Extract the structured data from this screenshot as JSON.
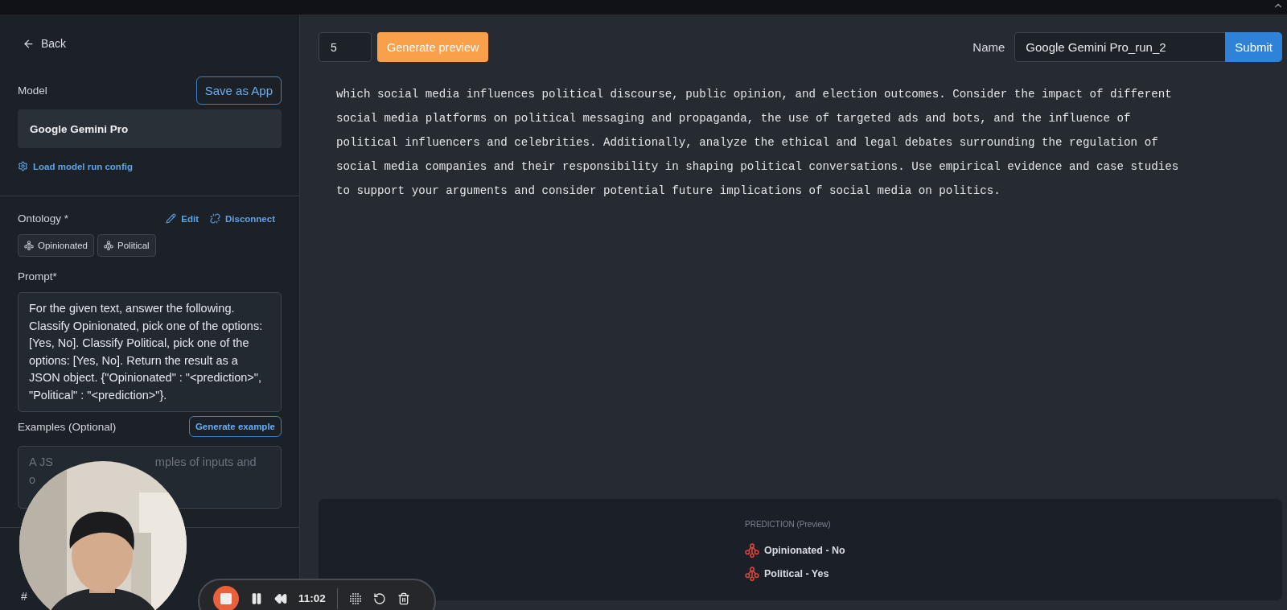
{
  "back": {
    "label": "Back"
  },
  "model": {
    "label": "Model",
    "save_button": "Save as App",
    "value": "Google Gemini Pro",
    "config_link": "Load model run config"
  },
  "ontology": {
    "label": "Ontology *",
    "edit": "Edit",
    "disconnect": "Disconnect",
    "chips": [
      "Opinionated",
      "Political"
    ]
  },
  "prompt": {
    "label": "Prompt*",
    "value": "For the given text, answer the following. Classify Opinionated, pick one of the options: [Yes, No]. Classify Political, pick one of the options: [Yes, No]. Return the result as a JSON object. {\"Opinionated\" : \"<prediction>\", \"Political\" : \"<prediction>\"}."
  },
  "examples": {
    "label": "Examples (Optional)",
    "button": "Generate example",
    "placeholder_parts": [
      "A JS",
      "mples of inputs and",
      "o"
    ]
  },
  "footer_hint": "#",
  "toolbar": {
    "count": "5",
    "generate_button": "Generate preview",
    "name_label": "Name",
    "name_value": "Google Gemini Pro_run_2",
    "submit": "Submit"
  },
  "document": {
    "lines": [
      "which social media influences political discourse, public opinion, and election outcomes. Consider the impact of different",
      "social media platforms on political messaging and propaganda, the use of targeted ads and bots, and the influence of",
      "political influencers and celebrities. Additionally, analyze the ethical and legal debates surrounding the regulation of",
      "social media companies and their responsibility in shaping political conversations. Use empirical evidence and case studies",
      "to support your arguments and consider potential future implications of social media on politics."
    ]
  },
  "prediction": {
    "title": "PREDICTION (Preview)",
    "items": [
      {
        "label": "Opinionated - No"
      },
      {
        "label": "Political - Yes"
      }
    ]
  },
  "recorder": {
    "time": "11:02"
  }
}
